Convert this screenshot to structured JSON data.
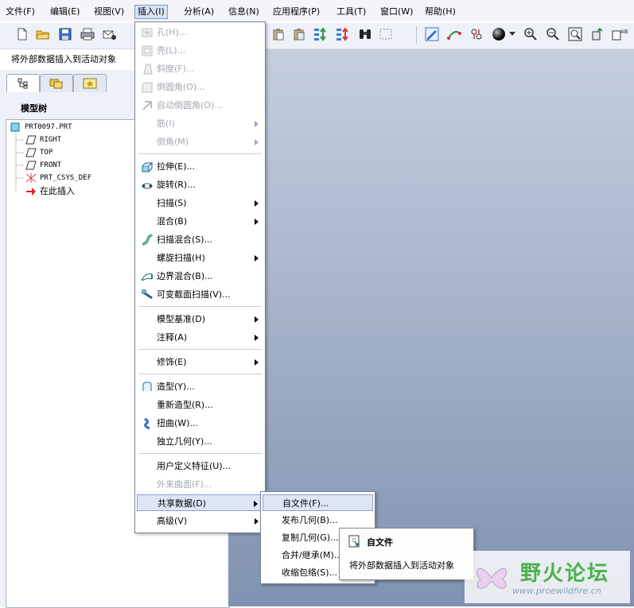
{
  "menubar": {
    "items": [
      {
        "label": "文件(F)"
      },
      {
        "label": "编辑(E)"
      },
      {
        "label": "视图(V)"
      },
      {
        "label": "插入(I)"
      },
      {
        "label": "分析(A)"
      },
      {
        "label": "信息(N)"
      },
      {
        "label": "应用程序(P)"
      },
      {
        "label": "工具(T)"
      },
      {
        "label": "窗口(W)"
      },
      {
        "label": "帮助(H)"
      }
    ]
  },
  "message_line": "将外部数据插入到活动对象",
  "model_tree": {
    "title": "模型树",
    "items": [
      {
        "label": "PRT0097.PRT",
        "icon": "part-icon"
      },
      {
        "label": "RIGHT",
        "icon": "datum-plane-icon"
      },
      {
        "label": "TOP",
        "icon": "datum-plane-icon"
      },
      {
        "label": "FRONT",
        "icon": "datum-plane-icon"
      },
      {
        "label": "PRT_CSYS_DEF",
        "icon": "csys-icon"
      },
      {
        "label": "在此插入",
        "icon": "insert-here-arrow-icon"
      }
    ]
  },
  "insert_menu": {
    "items": [
      {
        "label": "孔(H)...",
        "icon": "hole-icon"
      },
      {
        "label": "壳(L)...",
        "icon": "shell-icon"
      },
      {
        "label": "斜度(F)...",
        "icon": "draft-icon"
      },
      {
        "label": "倒圆角(O)...",
        "icon": "round-icon"
      },
      {
        "label": "自动倒圆角(O)...",
        "icon": "auto-round-icon"
      },
      {
        "label": "筋(I)"
      },
      {
        "label": "倒角(M)"
      },
      {
        "label": "拉伸(E)...",
        "icon": "extrude-icon"
      },
      {
        "label": "旋转(R)...",
        "icon": "revolve-icon"
      },
      {
        "label": "扫描(S)"
      },
      {
        "label": "混合(B)"
      },
      {
        "label": "扫描混合(S)...",
        "icon": "swept-blend-icon"
      },
      {
        "label": "螺旋扫描(H)"
      },
      {
        "label": "边界混合(B)...",
        "icon": "boundary-blend-icon"
      },
      {
        "label": "可变截面扫描(V)...",
        "icon": "variable-section-sweep-icon"
      },
      {
        "label": "模型基准(D)"
      },
      {
        "label": "注释(A)"
      },
      {
        "label": "修饰(E)"
      },
      {
        "label": "造型(Y)...",
        "icon": "style-icon"
      },
      {
        "label": "重新造型(R)..."
      },
      {
        "label": "扭曲(W)...",
        "icon": "warp-icon"
      },
      {
        "label": "独立几何(Y)..."
      },
      {
        "label": "用户定义特征(U)..."
      },
      {
        "label": "外来曲面(F)..."
      },
      {
        "label": "共享数据(D)"
      },
      {
        "label": "高级(V)"
      }
    ]
  },
  "shared_data_submenu": {
    "items": [
      {
        "label": "自文件(F)..."
      },
      {
        "label": "发布几何(B)..."
      },
      {
        "label": "复制几何(G)..."
      },
      {
        "label": "合并/继承(M)..."
      },
      {
        "label": "收缩包络(S)..."
      }
    ]
  },
  "tooltip": {
    "title": "自文件",
    "description": "将外部数据插入到活动对象"
  },
  "watermark": {
    "text": "野火论坛",
    "url": "www.proewildfire.cn"
  },
  "colors": {
    "viewport_top": "#c4cedd",
    "viewport_bottom": "#7f92b1",
    "highlight": "#dce6f7",
    "disabled_text": "#a3a8b1",
    "watermark_green": "#4bb24b"
  }
}
